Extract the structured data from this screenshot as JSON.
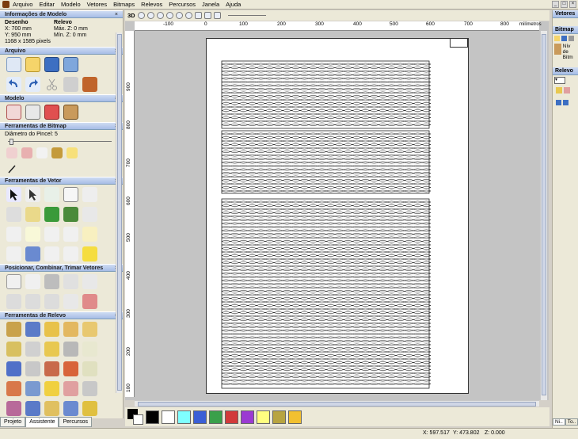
{
  "menu": [
    "Arquivo",
    "Editar",
    "Modelo",
    "Vetores",
    "Bitmaps",
    "Relevos",
    "Percursos",
    "Janela",
    "Ajuda"
  ],
  "window_controls": [
    "_",
    "□",
    "×"
  ],
  "left_panel": {
    "model_info": {
      "title": "Informações de Modelo",
      "close": "×",
      "desenho_label": "Desenho",
      "relevo_label": "Relevo",
      "x": "X: 700 mm",
      "y": "Y: 950 mm",
      "pixels": "1168 x 1585 pixels",
      "max_z": "Máx. Z: 0 mm",
      "min_z": "Mín. Z: 0 mm"
    },
    "sections": {
      "arquivo": "Arquivo",
      "modelo": "Modelo",
      "bitmap_tools": "Ferramentas de Bitmap",
      "vector_tools": "Ferramentas de Vetor",
      "position_tools": "Posicionar, Combinar, Trimar Vetores",
      "relief_tools": "Ferramentas de Relevo"
    },
    "brush_label": "Diâmetro do Pincel:",
    "brush_value": "5",
    "tabs": [
      "Projeto",
      "Assistente",
      "Percursos"
    ]
  },
  "viewbar": {
    "mode": "3D"
  },
  "ruler": {
    "unit": "milímetros",
    "h_labels": [
      "-100",
      "0",
      "100",
      "200",
      "300",
      "400",
      "500",
      "600",
      "700",
      "800"
    ],
    "v_labels": [
      "900",
      "800",
      "700",
      "600",
      "500",
      "400",
      "300",
      "200",
      "100",
      "0"
    ]
  },
  "palette": {
    "colors": [
      "#000000",
      "#ffffff",
      "#7fffff",
      "#3b5fd6",
      "#3aa04a",
      "#d23a3a",
      "#9b3ad2",
      "#ffff80",
      "#b8a440",
      "#f2c030"
    ]
  },
  "status": {
    "x": "X: 597.517",
    "y": "Y: 473.802",
    "z": "Z: 0.000"
  },
  "right_panel": {
    "title": "Vetores",
    "bitmap_title": "Bitmap",
    "bitmap_text": "Nív de Bitm",
    "relevo_title": "Relevo",
    "tabs": [
      "Ni..",
      "To.."
    ]
  }
}
